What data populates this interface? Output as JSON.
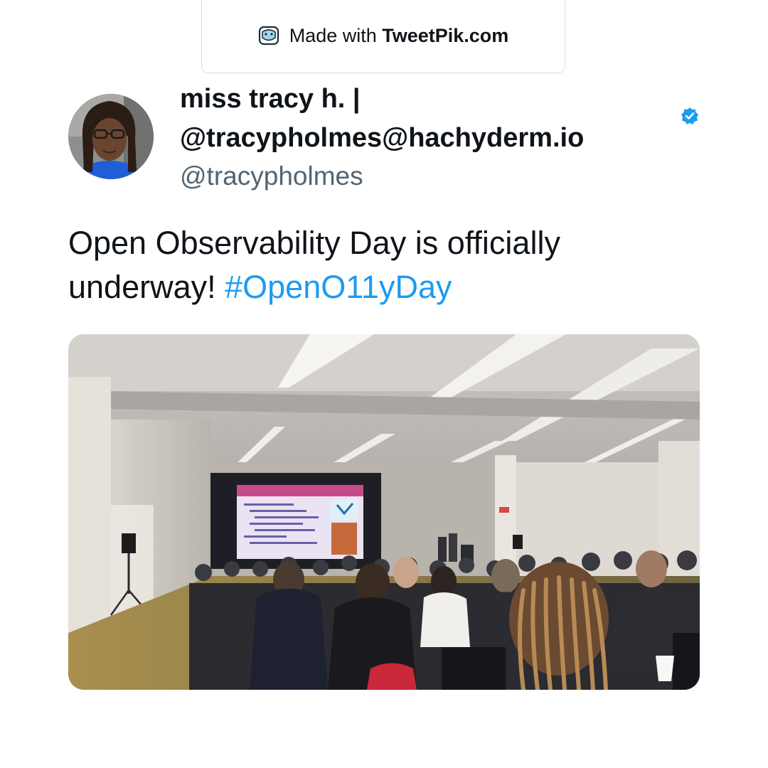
{
  "watermark": {
    "prefix": "Made with ",
    "brand": "TweetPik.com",
    "icon": "tweetpik-bird-icon"
  },
  "author": {
    "display_name": "miss tracy h. | @tracypholmes@hachyderm.io",
    "handle": "@tracypholmes",
    "verified": true,
    "verified_color": "#1d9bf0"
  },
  "tweet": {
    "text": "Open Observability Day is officially underway! ",
    "hashtag": "#OpenO11yDay",
    "hashtag_color": "#1d9bf0"
  },
  "media": {
    "type": "photo",
    "subject": "conference-room-presentation"
  }
}
